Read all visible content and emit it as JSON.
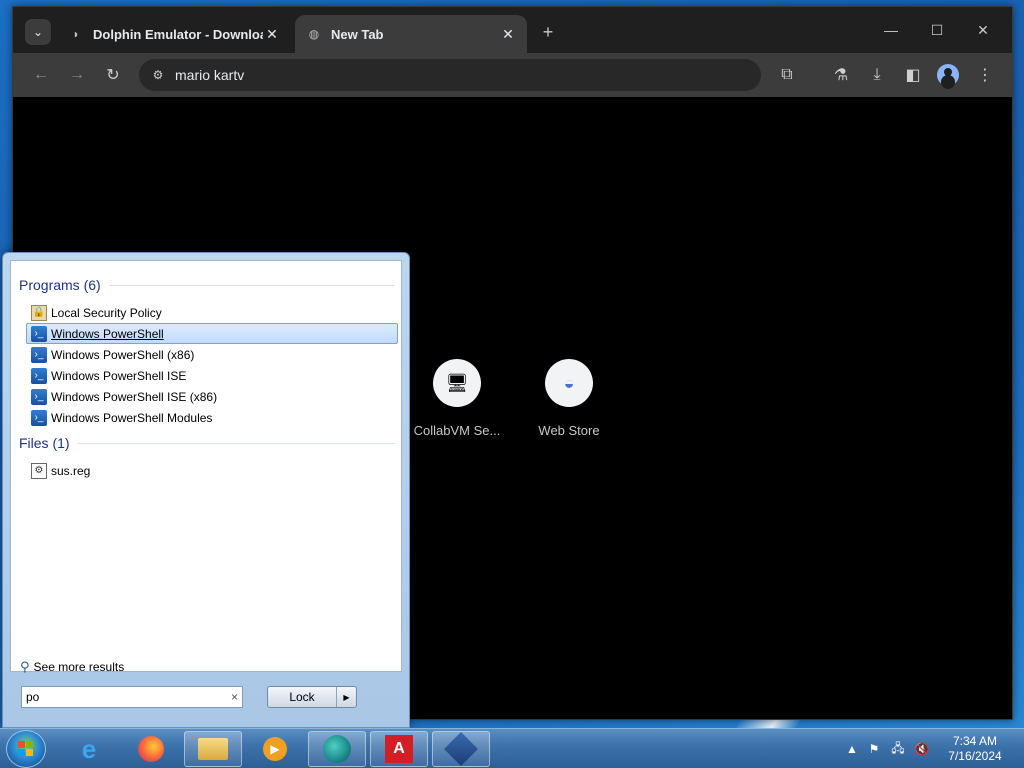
{
  "browser": {
    "tabs": [
      {
        "title": "Dolphin Emulator - Download",
        "close": "✕"
      },
      {
        "title": "New Tab",
        "close": "✕"
      }
    ],
    "new_tab": "+",
    "window_controls": {
      "minimize": "—",
      "maximize": "☐",
      "close": "✕"
    },
    "address_value": "mario kartv",
    "shortcuts": [
      {
        "label": "CollabVM Se...",
        "icon": "collabvm-icon"
      },
      {
        "label": "Web Store",
        "icon": "webstore-icon"
      }
    ]
  },
  "start_menu": {
    "programs_heading": "Programs (6)",
    "programs": [
      {
        "label": "Local Security Policy",
        "icon": "security-policy-icon"
      },
      {
        "label": "Windows PowerShell",
        "icon": "powershell-icon",
        "highlighted": true
      },
      {
        "label": "Windows PowerShell (x86)",
        "icon": "powershell-icon"
      },
      {
        "label": "Windows PowerShell ISE",
        "icon": "powershell-ise-icon"
      },
      {
        "label": "Windows PowerShell ISE (x86)",
        "icon": "powershell-ise-icon"
      },
      {
        "label": "Windows PowerShell Modules",
        "icon": "powershell-icon"
      }
    ],
    "files_heading": "Files (1)",
    "files": [
      {
        "label": "sus.reg",
        "icon": "registry-file-icon"
      }
    ],
    "see_more": "See more results",
    "search_value": "po",
    "search_clear": "×",
    "lock_label": "Lock",
    "lock_arrow": "▶"
  },
  "taskbar": {
    "apps": [
      "internet-explorer-icon",
      "firefox-icon",
      "file-explorer-icon",
      "media-player-icon",
      "browser-app-icon",
      "avira-icon",
      "virtualbox-icon"
    ],
    "clock_time": "7:34 AM",
    "clock_date": "7/16/2024"
  }
}
